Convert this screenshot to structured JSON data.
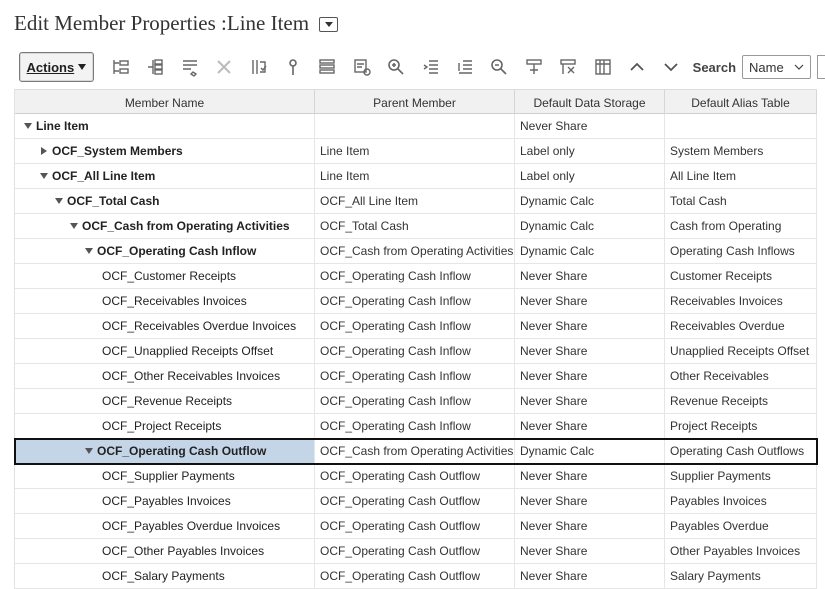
{
  "title": "Edit Member Properties :Line Item",
  "toolbar": {
    "actions_label": "Actions",
    "search_label": "Search",
    "search_field": "Name"
  },
  "columns": [
    "Member Name",
    "Parent Member",
    "Default Data Storage",
    "Default Alias Table"
  ],
  "rows": [
    {
      "name": "Line Item",
      "parent": "",
      "storage": "Never Share",
      "alias": ""
    },
    {
      "name": "OCF_System Members",
      "parent": "Line Item",
      "storage": "Label only",
      "alias": "System Members"
    },
    {
      "name": "OCF_All Line Item",
      "parent": "Line Item",
      "storage": "Label only",
      "alias": "All Line Item"
    },
    {
      "name": "OCF_Total Cash",
      "parent": "OCF_All Line Item",
      "storage": "Dynamic Calc",
      "alias": "Total Cash"
    },
    {
      "name": "OCF_Cash from Operating Activities",
      "parent": "OCF_Total Cash",
      "storage": "Dynamic Calc",
      "alias": "Cash from Operating"
    },
    {
      "name": "OCF_Operating Cash Inflow",
      "parent": "OCF_Cash from Operating Activities",
      "storage": "Dynamic Calc",
      "alias": "Operating Cash Inflows"
    },
    {
      "name": "OCF_Customer Receipts",
      "parent": "OCF_Operating Cash Inflow",
      "storage": "Never Share",
      "alias": "Customer Receipts"
    },
    {
      "name": "OCF_Receivables Invoices",
      "parent": "OCF_Operating Cash Inflow",
      "storage": "Never Share",
      "alias": "Receivables Invoices"
    },
    {
      "name": "OCF_Receivables Overdue Invoices",
      "parent": "OCF_Operating Cash Inflow",
      "storage": "Never Share",
      "alias": "Receivables Overdue"
    },
    {
      "name": "OCF_Unapplied Receipts Offset",
      "parent": "OCF_Operating Cash Inflow",
      "storage": "Never Share",
      "alias": "Unapplied Receipts Offset"
    },
    {
      "name": "OCF_Other Receivables Invoices",
      "parent": "OCF_Operating Cash Inflow",
      "storage": "Never Share",
      "alias": "Other Receivables"
    },
    {
      "name": "OCF_Revenue Receipts",
      "parent": "OCF_Operating Cash Inflow",
      "storage": "Never Share",
      "alias": "Revenue Receipts"
    },
    {
      "name": "OCF_Project Receipts",
      "parent": "OCF_Operating Cash Inflow",
      "storage": "Never Share",
      "alias": "Project Receipts"
    },
    {
      "name": "OCF_Operating Cash Outflow",
      "parent": "OCF_Cash from Operating Activities",
      "storage": "Dynamic Calc",
      "alias": "Operating Cash Outflows"
    },
    {
      "name": "OCF_Supplier Payments",
      "parent": "OCF_Operating Cash Outflow",
      "storage": "Never Share",
      "alias": "Supplier Payments"
    },
    {
      "name": "OCF_Payables Invoices",
      "parent": "OCF_Operating Cash Outflow",
      "storage": "Never Share",
      "alias": "Payables Invoices"
    },
    {
      "name": "OCF_Payables Overdue Invoices",
      "parent": "OCF_Operating Cash Outflow",
      "storage": "Never Share",
      "alias": "Payables Overdue"
    },
    {
      "name": "OCF_Other Payables Invoices",
      "parent": "OCF_Operating Cash Outflow",
      "storage": "Never Share",
      "alias": "Other Payables Invoices"
    },
    {
      "name": "OCF_Salary Payments",
      "parent": "OCF_Operating Cash Outflow",
      "storage": "Never Share",
      "alias": "Salary Payments"
    }
  ]
}
